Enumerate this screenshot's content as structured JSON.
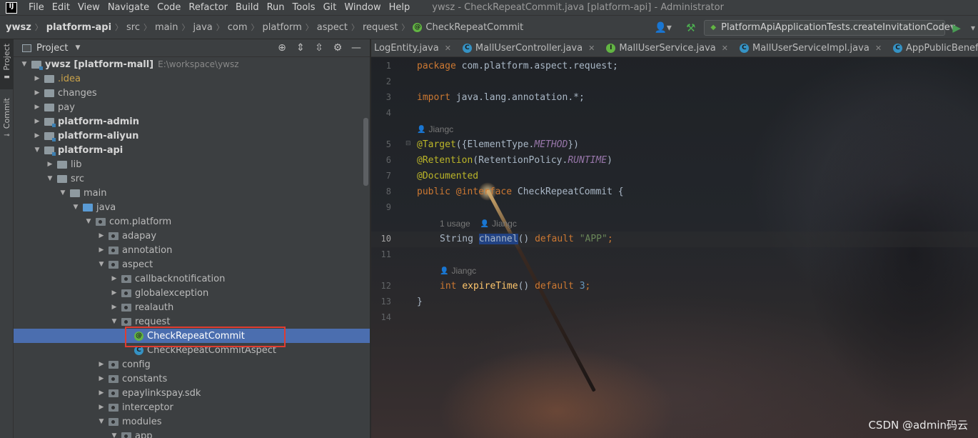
{
  "menubar": {
    "logo": "IJ",
    "items": [
      "File",
      "Edit",
      "View",
      "Navigate",
      "Code",
      "Refactor",
      "Build",
      "Run",
      "Tools",
      "Git",
      "Window",
      "Help"
    ],
    "window_title": "ywsz - CheckRepeatCommit.java [platform-api] - Administrator"
  },
  "navbar": {
    "crumbs": [
      "ywsz",
      "platform-api",
      "src",
      "main",
      "java",
      "com",
      "platform",
      "aspect",
      "request",
      "CheckRepeatCommit"
    ],
    "run_config": "PlatformApiApplicationTests.createInvitationCode"
  },
  "left_stripe": {
    "project_tab": "Project",
    "commit_tab": "Commit"
  },
  "project_panel": {
    "title": "Project",
    "tree": [
      {
        "label": "ywsz [platform-mall]",
        "path": "E:\\workspace\\ywsz",
        "indent": 0,
        "arrow": "open",
        "icon": "module",
        "style": "bold"
      },
      {
        "label": ".idea",
        "indent": 1,
        "arrow": "closed",
        "icon": "folder",
        "style": "idea"
      },
      {
        "label": "changes",
        "indent": 1,
        "arrow": "closed",
        "icon": "folder",
        "style": "normal"
      },
      {
        "label": "pay",
        "indent": 1,
        "arrow": "closed",
        "icon": "folder",
        "style": "normal"
      },
      {
        "label": "platform-admin",
        "indent": 1,
        "arrow": "closed",
        "icon": "module",
        "style": "bold"
      },
      {
        "label": "platform-aliyun",
        "indent": 1,
        "arrow": "closed",
        "icon": "module",
        "style": "bold"
      },
      {
        "label": "platform-api",
        "indent": 1,
        "arrow": "open",
        "icon": "module",
        "style": "bold"
      },
      {
        "label": "lib",
        "indent": 2,
        "arrow": "closed",
        "icon": "folder",
        "style": "normal"
      },
      {
        "label": "src",
        "indent": 2,
        "arrow": "open",
        "icon": "folder",
        "style": "normal"
      },
      {
        "label": "main",
        "indent": 3,
        "arrow": "open",
        "icon": "folder",
        "style": "normal"
      },
      {
        "label": "java",
        "indent": 4,
        "arrow": "open",
        "icon": "src",
        "style": "normal"
      },
      {
        "label": "com.platform",
        "indent": 5,
        "arrow": "open",
        "icon": "pkg",
        "style": "normal"
      },
      {
        "label": "adapay",
        "indent": 6,
        "arrow": "closed",
        "icon": "pkg",
        "style": "normal"
      },
      {
        "label": "annotation",
        "indent": 6,
        "arrow": "closed",
        "icon": "pkg",
        "style": "normal"
      },
      {
        "label": "aspect",
        "indent": 6,
        "arrow": "open",
        "icon": "pkg",
        "style": "normal"
      },
      {
        "label": "callbacknotification",
        "indent": 7,
        "arrow": "closed",
        "icon": "pkg",
        "style": "normal"
      },
      {
        "label": "globalexception",
        "indent": 7,
        "arrow": "closed",
        "icon": "pkg",
        "style": "normal"
      },
      {
        "label": "realauth",
        "indent": 7,
        "arrow": "closed",
        "icon": "pkg",
        "style": "normal"
      },
      {
        "label": "request",
        "indent": 7,
        "arrow": "open",
        "icon": "pkg",
        "style": "normal"
      },
      {
        "label": "CheckRepeatCommit",
        "indent": 8,
        "arrow": "none",
        "icon": "annotation",
        "style": "normal",
        "selected": true
      },
      {
        "label": "CheckRepeatCommitAspect",
        "indent": 8,
        "arrow": "none",
        "icon": "class",
        "style": "normal"
      },
      {
        "label": "config",
        "indent": 6,
        "arrow": "closed",
        "icon": "pkg",
        "style": "normal"
      },
      {
        "label": "constants",
        "indent": 6,
        "arrow": "closed",
        "icon": "pkg",
        "style": "normal"
      },
      {
        "label": "epaylinkspay.sdk",
        "indent": 6,
        "arrow": "closed",
        "icon": "pkg",
        "style": "normal"
      },
      {
        "label": "interceptor",
        "indent": 6,
        "arrow": "closed",
        "icon": "pkg",
        "style": "normal"
      },
      {
        "label": "modules",
        "indent": 6,
        "arrow": "open",
        "icon": "pkg",
        "style": "normal"
      },
      {
        "label": "app",
        "indent": 7,
        "arrow": "open",
        "icon": "pkg",
        "style": "normal"
      }
    ]
  },
  "editor": {
    "tabs": [
      {
        "label": "LogEntity.java",
        "icon": "none"
      },
      {
        "label": "MallUserController.java",
        "icon": "class"
      },
      {
        "label": "MallUserService.java",
        "icon": "interface"
      },
      {
        "label": "MallUserServiceImpl.java",
        "icon": "class"
      },
      {
        "label": "AppPublicBenefitController.ja",
        "icon": "class"
      }
    ],
    "hints": {
      "author_1": "Jiangc",
      "usages": "1 usage",
      "author_2": "Jiangc",
      "author_3": "Jiangc"
    },
    "code": {
      "l1_kw": "package",
      "l1_rest": " com.platform.aspect.request;",
      "l3_kw": "import",
      "l3_rest": " java.lang.annotation.*;",
      "l5_ann": "@Target",
      "l5_a": "({ElementType.",
      "l5_const": "METHOD",
      "l5_b": "})",
      "l6_ann": "@Retention",
      "l6_a": "(RetentionPolicy.",
      "l6_const": "RUNTIME",
      "l6_b": ")",
      "l7_ann": "@Documented",
      "l8_kw": "public",
      "l8_ann": " @interface",
      "l8_rest": " CheckRepeatCommit {",
      "l10_type": "String ",
      "l10_fn": "channel",
      "l10_paren": "() ",
      "l10_kw": "default",
      "l10_str": " \"APP\"",
      "l10_semi": ";",
      "l12_kw": "int ",
      "l12_fn": "expireTime",
      "l12_paren": "() ",
      "l12_kw2": "default",
      "l12_num": " 3",
      "l12_semi": ";",
      "l13": "}"
    },
    "line_numbers": [
      "1",
      "2",
      "3",
      "4",
      "5",
      "6",
      "7",
      "8",
      "9",
      "10",
      "11",
      "12",
      "13",
      "14"
    ]
  },
  "watermark": "CSDN @admin码云"
}
